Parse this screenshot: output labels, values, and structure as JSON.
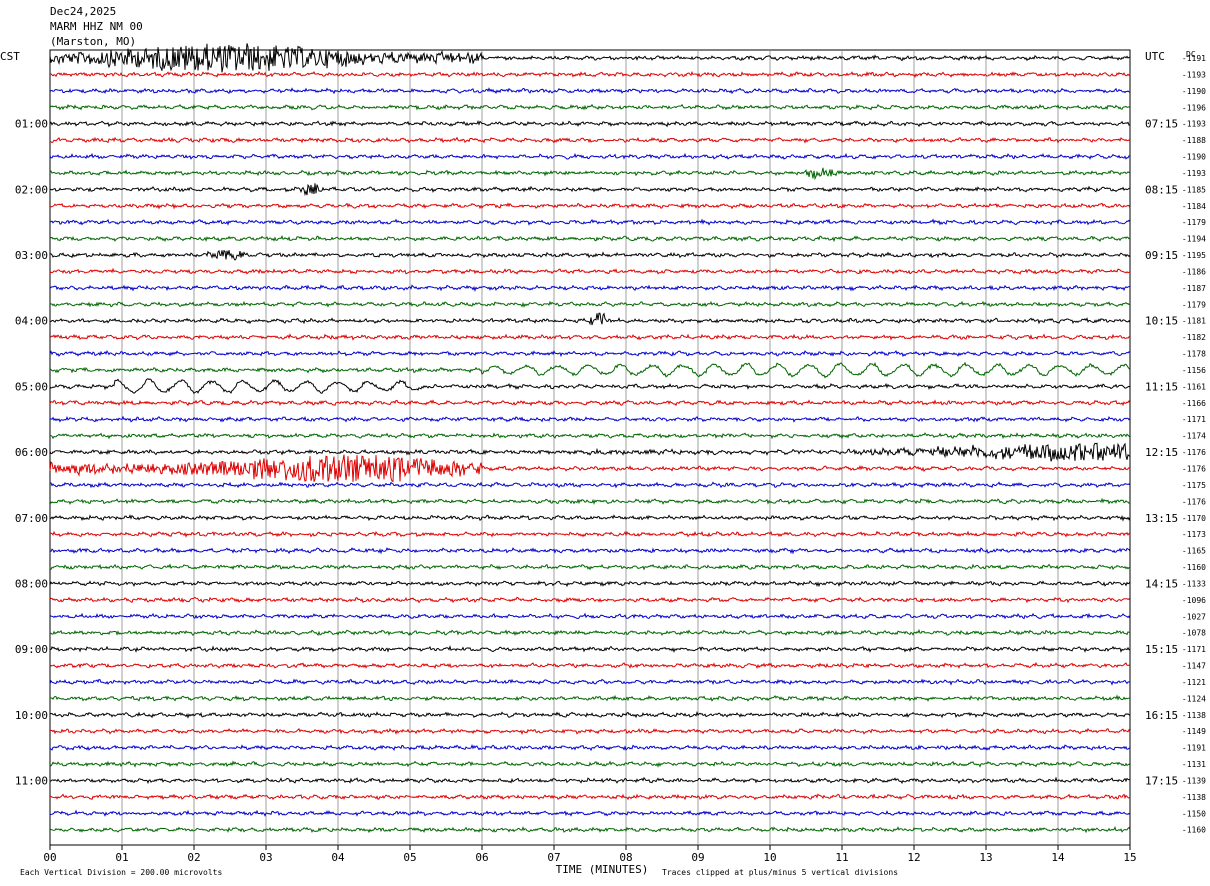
{
  "header": {
    "date": "Dec24,2025",
    "station": "MARM HHZ NM 00",
    "location": "(Marston, MO)"
  },
  "left_zone": "CST",
  "right_zone": "UTC",
  "dc_label": "DC",
  "footer": {
    "scale_note": "Each Vertical Division =  200.00 microvolts",
    "xlabel": "TIME (MINUTES)",
    "clip_note": "Traces clipped at plus/minus 5 vertical divisions"
  },
  "colors": {
    "c0": "#000000",
    "c1": "#dd0000",
    "c2": "#0000cc",
    "c3": "#006600",
    "grid": "#888888"
  },
  "chart_data": {
    "type": "line",
    "title": "MARM HHZ NM 00",
    "xlabel": "TIME (MINUTES)",
    "xlim": [
      0,
      15
    ],
    "x_ticks": [
      "00",
      "01",
      "02",
      "03",
      "04",
      "05",
      "06",
      "07",
      "08",
      "09",
      "10",
      "11",
      "12",
      "13",
      "14",
      "15"
    ],
    "trace_count": 48,
    "trace_minutes": 15,
    "left_hour_labels": [
      "01:00",
      "02:00",
      "03:00",
      "04:00",
      "05:00",
      "06:00",
      "07:00",
      "08:00",
      "09:00",
      "10:00",
      "11:00"
    ],
    "right_hour_labels": [
      "07:15",
      "08:15",
      "09:15",
      "10:15",
      "11:15",
      "12:15",
      "13:15",
      "14:15",
      "15:15",
      "16:15",
      "17:15"
    ],
    "dc_offsets": [
      -1191,
      -1193,
      -1190,
      -1196,
      -1193,
      -1188,
      -1190,
      -1193,
      -1185,
      -1184,
      -1179,
      -1194,
      -1195,
      -1186,
      -1187,
      -1179,
      -1181,
      -1182,
      -1178,
      -1156,
      -1161,
      -1166,
      -1171,
      -1174,
      -1176,
      -1176,
      -1175,
      -1176,
      -1170,
      -1173,
      -1165,
      -1160,
      -1133,
      -1096,
      -1027,
      -1078,
      -1171,
      -1147,
      -1121,
      -1124,
      -1138,
      -1149,
      -1191,
      -1131,
      -1139,
      -1138,
      -1150,
      -1160
    ],
    "events": [
      {
        "trace": 0,
        "start_min": 0.0,
        "end_min": 6.0,
        "peak_min": 2.4,
        "amplitude": "high"
      },
      {
        "trace": 7,
        "start_min": 10.5,
        "end_min": 11.0,
        "peak_min": 10.7,
        "amplitude": "low"
      },
      {
        "trace": 8,
        "start_min": 3.4,
        "end_min": 3.8,
        "peak_min": 3.6,
        "amplitude": "low"
      },
      {
        "trace": 12,
        "start_min": 2.0,
        "end_min": 2.8,
        "peak_min": 2.5,
        "amplitude": "low"
      },
      {
        "trace": 16,
        "start_min": 7.5,
        "end_min": 7.8,
        "peak_min": 7.6,
        "amplitude": "medium"
      },
      {
        "trace": 19,
        "start_min": 6.0,
        "end_min": 15.0,
        "peak_min": 11.0,
        "amplitude": "long-period"
      },
      {
        "trace": 20,
        "start_min": 0.9,
        "end_min": 5.2,
        "peak_min": 1.2,
        "amplitude": "long-period"
      },
      {
        "trace": 24,
        "start_min": 7.5,
        "end_min": 15.0,
        "peak_min": 14.8,
        "amplitude": "medium"
      },
      {
        "trace": 25,
        "start_min": 0.0,
        "end_min": 6.0,
        "peak_min": 4.0,
        "amplitude": "high"
      }
    ]
  }
}
